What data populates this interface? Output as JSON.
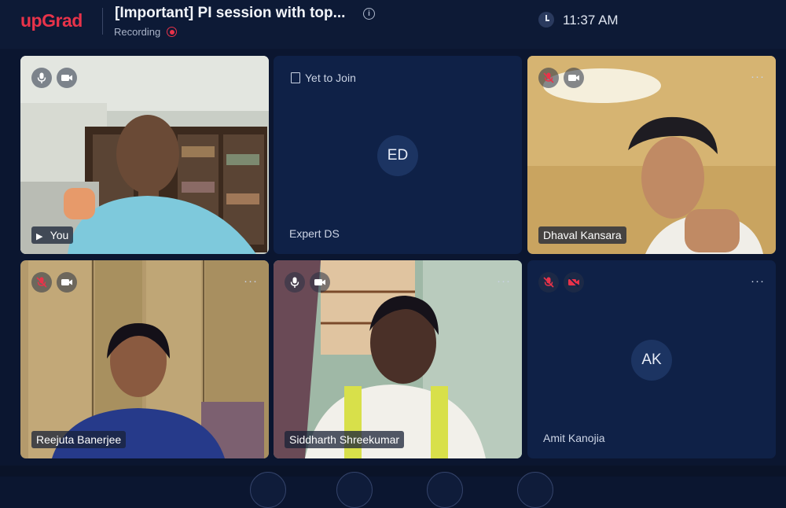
{
  "header": {
    "logo": "upGrad",
    "title": "[Important] PI session with top...",
    "recording_label": "Recording",
    "time": "11:37 AM"
  },
  "tiles": [
    {
      "name": "You",
      "mic": "on",
      "camera": "on"
    },
    {
      "name": "Expert DS",
      "status": "Yet to Join",
      "initials": "ED"
    },
    {
      "name": "Dhaval Kansara",
      "mic": "muted",
      "camera": "on"
    },
    {
      "name": "Reejuta Banerjee",
      "mic": "muted",
      "camera": "on"
    },
    {
      "name": "Siddharth Shreekumar",
      "mic": "on",
      "camera": "on"
    },
    {
      "name": "Amit Kanojia",
      "initials": "AK",
      "mic": "muted",
      "camera": "off"
    }
  ],
  "more_label": "···",
  "colors": {
    "brand": "#e8334a",
    "background": "#0b1630",
    "tile": "#0f2147",
    "muted": "#e8334a"
  }
}
